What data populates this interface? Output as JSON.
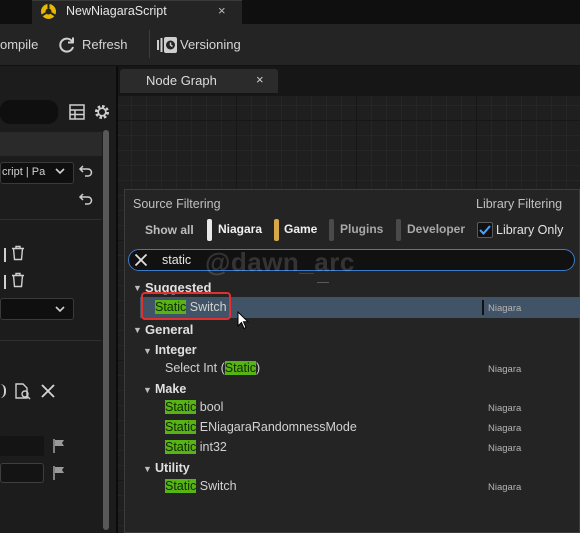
{
  "tab": {
    "title": "NewNiagaraScript",
    "close": "×"
  },
  "toolbar": {
    "compile_label": "ompile",
    "refresh_label": "Refresh",
    "versioning_label": "Versioning"
  },
  "left_panel": {
    "dropdown_value": "cript | Pa"
  },
  "graph_tab": {
    "label": "Node Graph",
    "close": "×"
  },
  "menu": {
    "source_filtering": "Source Filtering",
    "library_filtering": "Library Filtering",
    "show_all": "Show all",
    "chips": [
      {
        "label": "Niagara",
        "color": "#e8e8e8"
      },
      {
        "label": "Game",
        "color": "#d6a84a"
      },
      {
        "label": "Plugins",
        "color": "#4a4a4a"
      },
      {
        "label": "Developer",
        "color": "#4a4a4a"
      }
    ],
    "library_only": {
      "label": "Library Only",
      "checked": true
    },
    "search": {
      "value": "static"
    },
    "watermark": "@dawn_arc",
    "suggested": {
      "label": "Suggested",
      "items": [
        {
          "highlight": "Static",
          "rest": " Switch",
          "source": "Niagara",
          "selected": true
        }
      ]
    },
    "general": {
      "label": "General",
      "groups": [
        {
          "label": "Integer",
          "items": [
            {
              "prefix": "Select Int (",
              "highlight": "Static",
              "suffix": ")",
              "source": "Niagara"
            }
          ]
        },
        {
          "label": "Make",
          "items": [
            {
              "highlight": "Static",
              "rest": " bool",
              "source": "Niagara"
            },
            {
              "highlight": "Static",
              "rest": " ENiagaraRandomnessMode",
              "source": "Niagara"
            },
            {
              "highlight": "Static",
              "rest": " int32",
              "source": "Niagara"
            }
          ]
        },
        {
          "label": "Utility",
          "items": [
            {
              "highlight": "Static",
              "rest": " Switch",
              "source": "Niagara"
            }
          ]
        }
      ]
    }
  },
  "colors": {
    "accent_blue": "#3a7ac8",
    "highlight_green": "#58b414",
    "selection": "#415467",
    "annotation_red": "#e03030"
  }
}
